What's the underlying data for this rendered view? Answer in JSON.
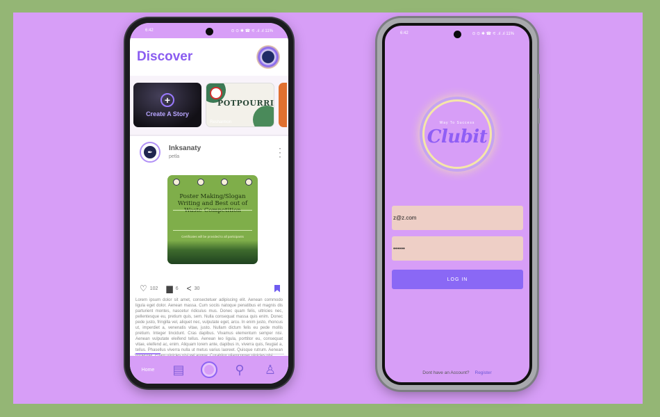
{
  "colors": {
    "background": "#94b675",
    "stage": "#d79ef7",
    "accent": "#8a5cf0",
    "button": "#8a68f5",
    "input": "#eecfc6"
  },
  "left_phone": {
    "status_time": "6:42",
    "status_icons": "⊙ ⊙ ✱ ☎ ⚟ .ıl .ıl 11%",
    "header": {
      "title": "Discover"
    },
    "stories": {
      "create_label": "Create A Story",
      "story_title": "POTPOURRI",
      "story_by": "Resharmon"
    },
    "post": {
      "author": "Inksanaty",
      "subtitle": "petla",
      "image_title": "Poster Making/Slogan Writing and Best out of Waste Competition",
      "image_note": "Certificates will be provided to all participants",
      "likes": "102",
      "comments": "6",
      "shares": "30",
      "body": "Lorem ipsum dolor sit amet, consectetuer adipiscing elit. Aenean commodo ligula eget dolor. Aenean massa. Cum sociis natoque penatibus et magnis dis parturient montes, nascetur ridiculus mus. Donec quam felis, ultricies nec, pellentesque eu, pretium quis, sem. Nulla consequat massa quis enim. Donec pede justo, fringilla vel, aliquet nec, vulputate eget, arcu. In enim justo, rhoncus ut, imperdiet a, venenatis vitae, justo. Nullam dictum felis eu pede mollis pretium. Integer tincidunt. Cras dapibus. Vivamus elementum semper nisi. Aenean vulputate eleifend tellus. Aenean leo ligula, porttitor eu, consequat vitae, eleifend ac, enim. Aliquam lorem ante, dapibus in, viverra quis, feugiat a, tellus. Phasellus viverra nulla ut metus varius laoreet. Quisque rutrum. Aenean imperdiet. Etiam ultricies nisi vel augue. Curabitur ullamcorper ultricies nisi."
    },
    "nav": {
      "home_label": "Home",
      "icons": [
        "home-icon",
        "news-icon",
        "club-icon",
        "search-icon",
        "profile-icon"
      ]
    }
  },
  "right_phone": {
    "status_time": "6:42",
    "status_icons": "⊙ ⊙ ✱ ☎ ⚟ .ıl .ıl 11%",
    "logo": {
      "tagline": "Way To Success",
      "name": "Clubit"
    },
    "email_value": "z@z.com",
    "password_value": "••••••",
    "login_label": "LOG IN",
    "signup_prompt": "Dont have an Account?",
    "register_label": "Register"
  }
}
